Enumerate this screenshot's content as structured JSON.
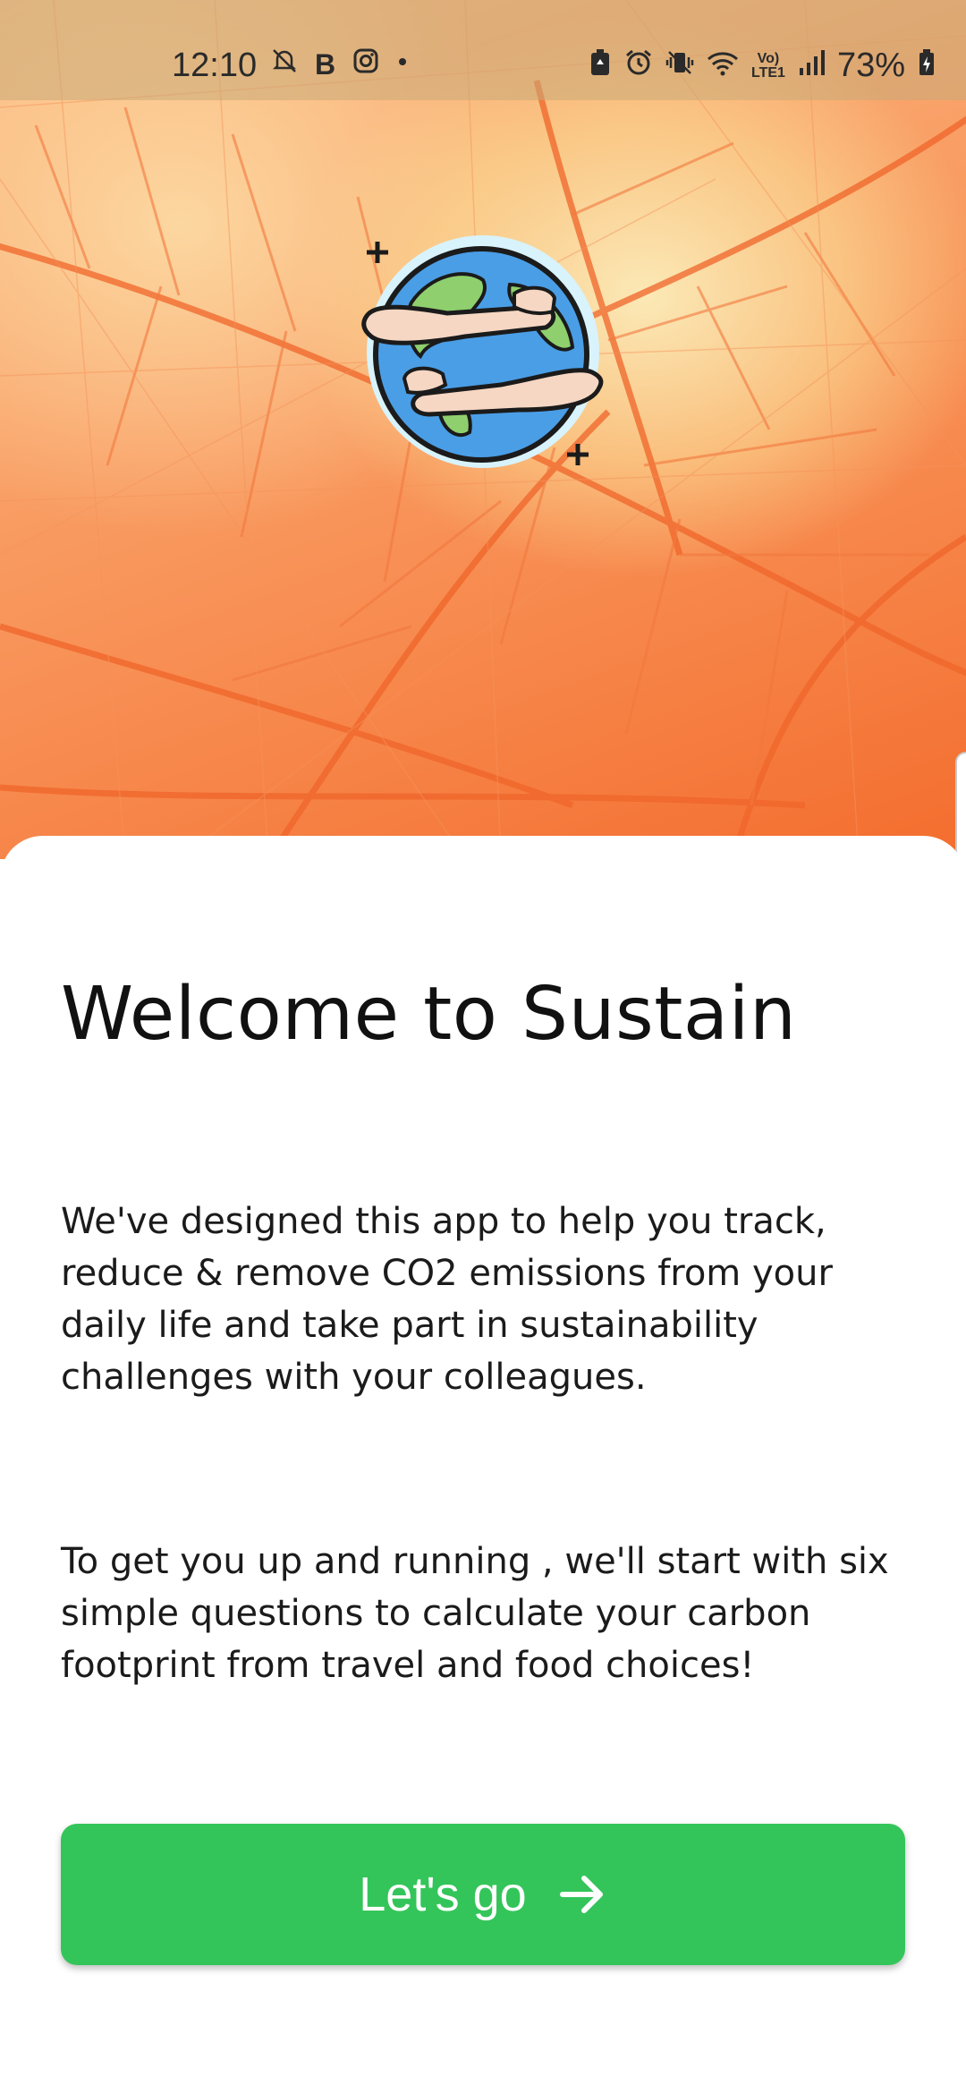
{
  "status_bar": {
    "time": "12:10",
    "left_icons": [
      "notifications-off-icon",
      "b-app-icon",
      "instagram-icon",
      "dot-icon"
    ],
    "right_icons": [
      "battery-saver-icon",
      "alarm-icon",
      "vibrate-icon",
      "wifi-icon",
      "volte-icon",
      "signal-icon"
    ],
    "battery_percent": "73%"
  },
  "hero": {
    "logo": "earth-hug-icon"
  },
  "welcome": {
    "title": "Welcome to Sustain",
    "paragraph_1": "We've designed this app to help you track, reduce & remove CO2 emissions from your daily life and take part in sustainability challenges with your colleagues.",
    "paragraph_2": "To get you up and running , we'll start with six simple questions to calculate your carbon footprint from travel and food choices!"
  },
  "cta": {
    "label": "Let's go",
    "icon": "arrow-right-icon",
    "color": "#34c55a"
  }
}
